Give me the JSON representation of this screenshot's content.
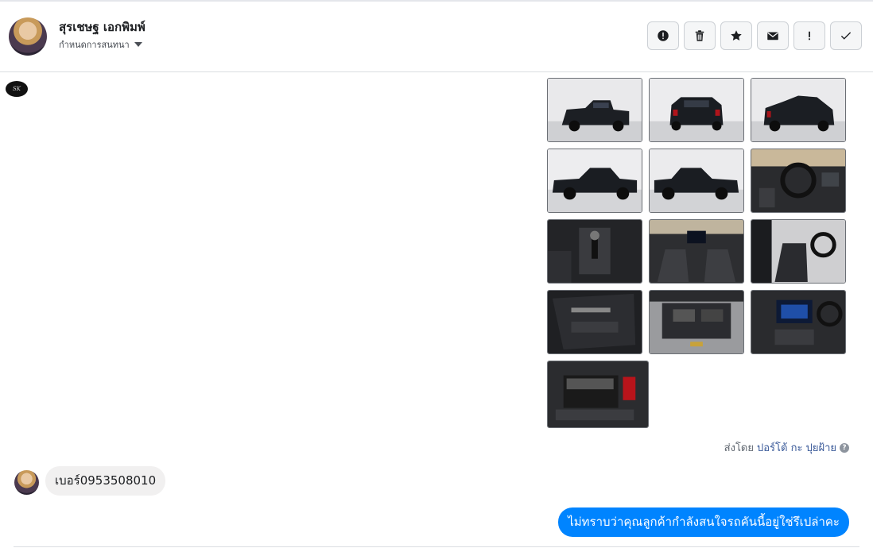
{
  "header": {
    "contact_name": "สุรเชษฐ เอกพิมพ์",
    "subtitle": "กำหนดการสนทนา",
    "actions": [
      {
        "name": "report-spam-button",
        "icon": "alert-circle-icon"
      },
      {
        "name": "delete-button",
        "icon": "trash-icon"
      },
      {
        "name": "star-button",
        "icon": "star-icon"
      },
      {
        "name": "mark-unread-button",
        "icon": "envelope-icon"
      },
      {
        "name": "mark-important-button",
        "icon": "exclamation-icon"
      },
      {
        "name": "mark-done-button",
        "icon": "check-icon"
      }
    ]
  },
  "page": {
    "logo_text": "SK"
  },
  "photos": [
    {
      "kind": "car-front-three-quarter"
    },
    {
      "kind": "car-rear"
    },
    {
      "kind": "car-rear-three-quarter"
    },
    {
      "kind": "car-side-right"
    },
    {
      "kind": "car-side-left"
    },
    {
      "kind": "interior-dashboard"
    },
    {
      "kind": "interior-gearshift"
    },
    {
      "kind": "interior-console"
    },
    {
      "kind": "interior-seats"
    },
    {
      "kind": "door-panel"
    },
    {
      "kind": "engine-bay"
    },
    {
      "kind": "infotainment"
    },
    {
      "kind": "battery"
    }
  ],
  "sent_by": {
    "prefix": "ส่งโดย",
    "name": "ปอร์โต้ กะ ปุยฝ้าย",
    "help": "?"
  },
  "messages": {
    "incoming": "เบอร์0953508010",
    "outgoing": "ไม่ทราบว่าคุณลูกค้ากำลังสนใจรถคันนี้อยู่ใช่รึเปล่าคะ"
  },
  "colors": {
    "accent": "#0084ff",
    "bubble_in": "#f1f0f0",
    "link": "#385898"
  }
}
